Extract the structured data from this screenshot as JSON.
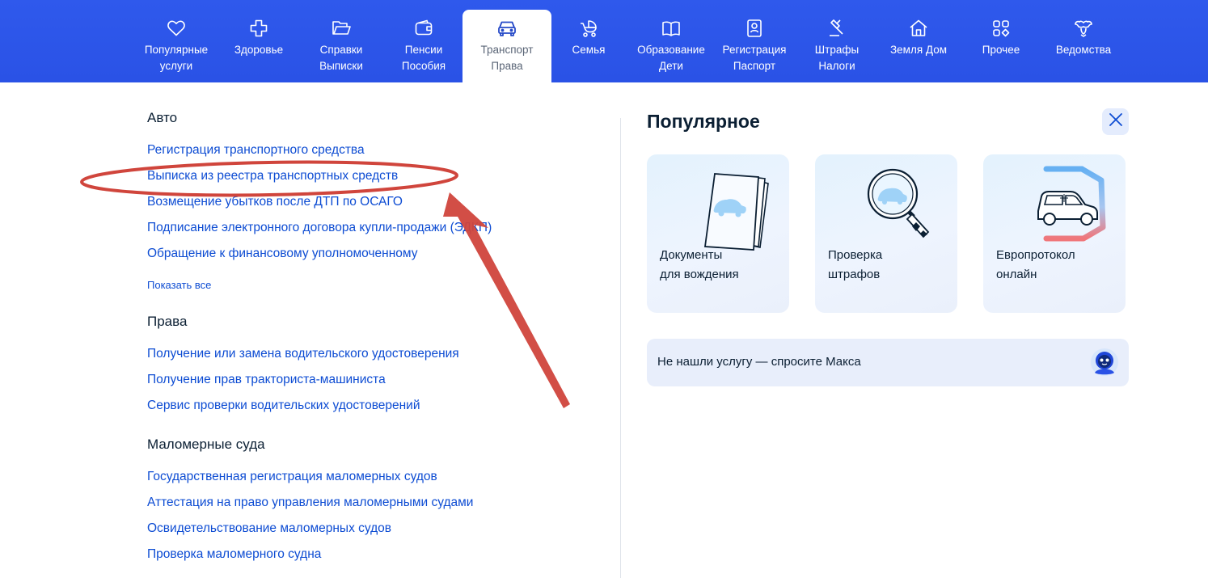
{
  "nav": {
    "items": [
      {
        "lines": [
          "Популярные",
          "услуги"
        ],
        "icon": "heart-icon"
      },
      {
        "lines": [
          "Здоровье"
        ],
        "icon": "health-cross-icon"
      },
      {
        "lines": [
          "Справки",
          "Выписки"
        ],
        "icon": "folder-icon"
      },
      {
        "lines": [
          "Пенсии",
          "Пособия"
        ],
        "icon": "wallet-icon"
      },
      {
        "lines": [
          "Транспорт",
          "Права"
        ],
        "icon": "car-icon",
        "active": true
      },
      {
        "lines": [
          "Семья"
        ],
        "icon": "stroller-icon"
      },
      {
        "lines": [
          "Образование",
          "Дети"
        ],
        "icon": "book-icon"
      },
      {
        "lines": [
          "Регистрация",
          "Паспорт"
        ],
        "icon": "passport-icon"
      },
      {
        "lines": [
          "Штрафы",
          "Налоги"
        ],
        "icon": "gavel-icon"
      },
      {
        "lines": [
          "Земля Дом"
        ],
        "icon": "house-icon"
      },
      {
        "lines": [
          "Прочее"
        ],
        "icon": "grid-icon"
      },
      {
        "lines": [
          "Ведомства"
        ],
        "icon": "emblem-icon"
      }
    ]
  },
  "sections": {
    "auto": {
      "title": "Авто",
      "links": [
        "Регистрация транспортного средства",
        "Выписка из реестра транспортных средств",
        "Возмещение убытков после ДТП по ОСАГО",
        "Подписание электронного договора купли-продажи (ЭДКП)",
        "Обращение к финансовому уполномоченному"
      ],
      "show_all": "Показать все"
    },
    "rights": {
      "title": "Права",
      "links": [
        "Получение или замена водительского удостоверения",
        "Получение прав тракториста-машиниста",
        "Сервис проверки водительских удостоверений"
      ]
    },
    "boats": {
      "title": "Маломерные суда",
      "links": [
        "Государственная регистрация маломерных судов",
        "Аттестация на право управления маломерными судами",
        "Освидетельствование маломерных судов",
        "Проверка маломерного судна"
      ]
    }
  },
  "popular": {
    "title": "Популярное",
    "cards": [
      {
        "lines": [
          "Документы",
          "для вождения"
        ],
        "icon": "documents-car-icon"
      },
      {
        "lines": [
          "Проверка",
          "штрафов"
        ],
        "icon": "magnifier-car-icon"
      },
      {
        "lines": [
          "Европротокол",
          "онлайн"
        ],
        "icon": "car-outline-icon"
      }
    ]
  },
  "ask": {
    "text": "Не нашли услугу — спросите Макса",
    "icon": "max-robot-icon"
  },
  "colors": {
    "nav_bg": "#2f59ec",
    "link": "#0d4cd3",
    "text": "#0b1f33",
    "annotation": "#d0453c"
  }
}
